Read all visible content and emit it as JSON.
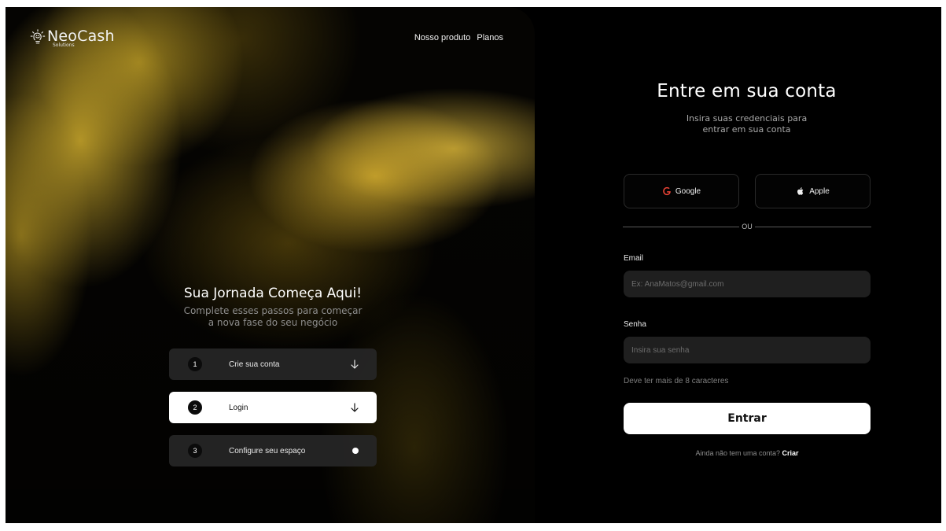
{
  "brand": {
    "name": "NeoCash",
    "subtitle": "Solutions"
  },
  "nav": {
    "items": [
      "Nosso produto",
      "Planos"
    ]
  },
  "hero": {
    "title": "Sua Jornada Começa Aqui!",
    "subtitle_line1": "Complete esses passos para começar",
    "subtitle_line2": "a nova fase do seu negócio"
  },
  "steps": [
    {
      "num": "1",
      "label": "Crie sua conta",
      "icon": "arrow-down-icon"
    },
    {
      "num": "2",
      "label": "Login",
      "icon": "arrow-down-icon",
      "active": true
    },
    {
      "num": "3",
      "label": "Configure seu espaço",
      "icon": "dot-icon"
    }
  ],
  "login": {
    "title": "Entre em sua conta",
    "subtitle_line1": "Insira suas credenciais para",
    "subtitle_line2": "entrar em sua conta",
    "google_label": "Google",
    "apple_label": "Apple",
    "divider": "OU",
    "email_label": "Email",
    "email_placeholder": "Ex: AnaMatos@gmail.com",
    "password_label": "Senha",
    "password_placeholder": "Insira sua senha",
    "password_hint": "Deve ter mais de 8 caracteres",
    "submit_label": "Entrar",
    "signup_text": "Ainda não tem uma conta?",
    "signup_link": "Criar"
  },
  "colors": {
    "background": "#000000",
    "accent_gold": "#f1c434",
    "button_white": "#ffffff",
    "field_bg": "#1f1f1f"
  }
}
